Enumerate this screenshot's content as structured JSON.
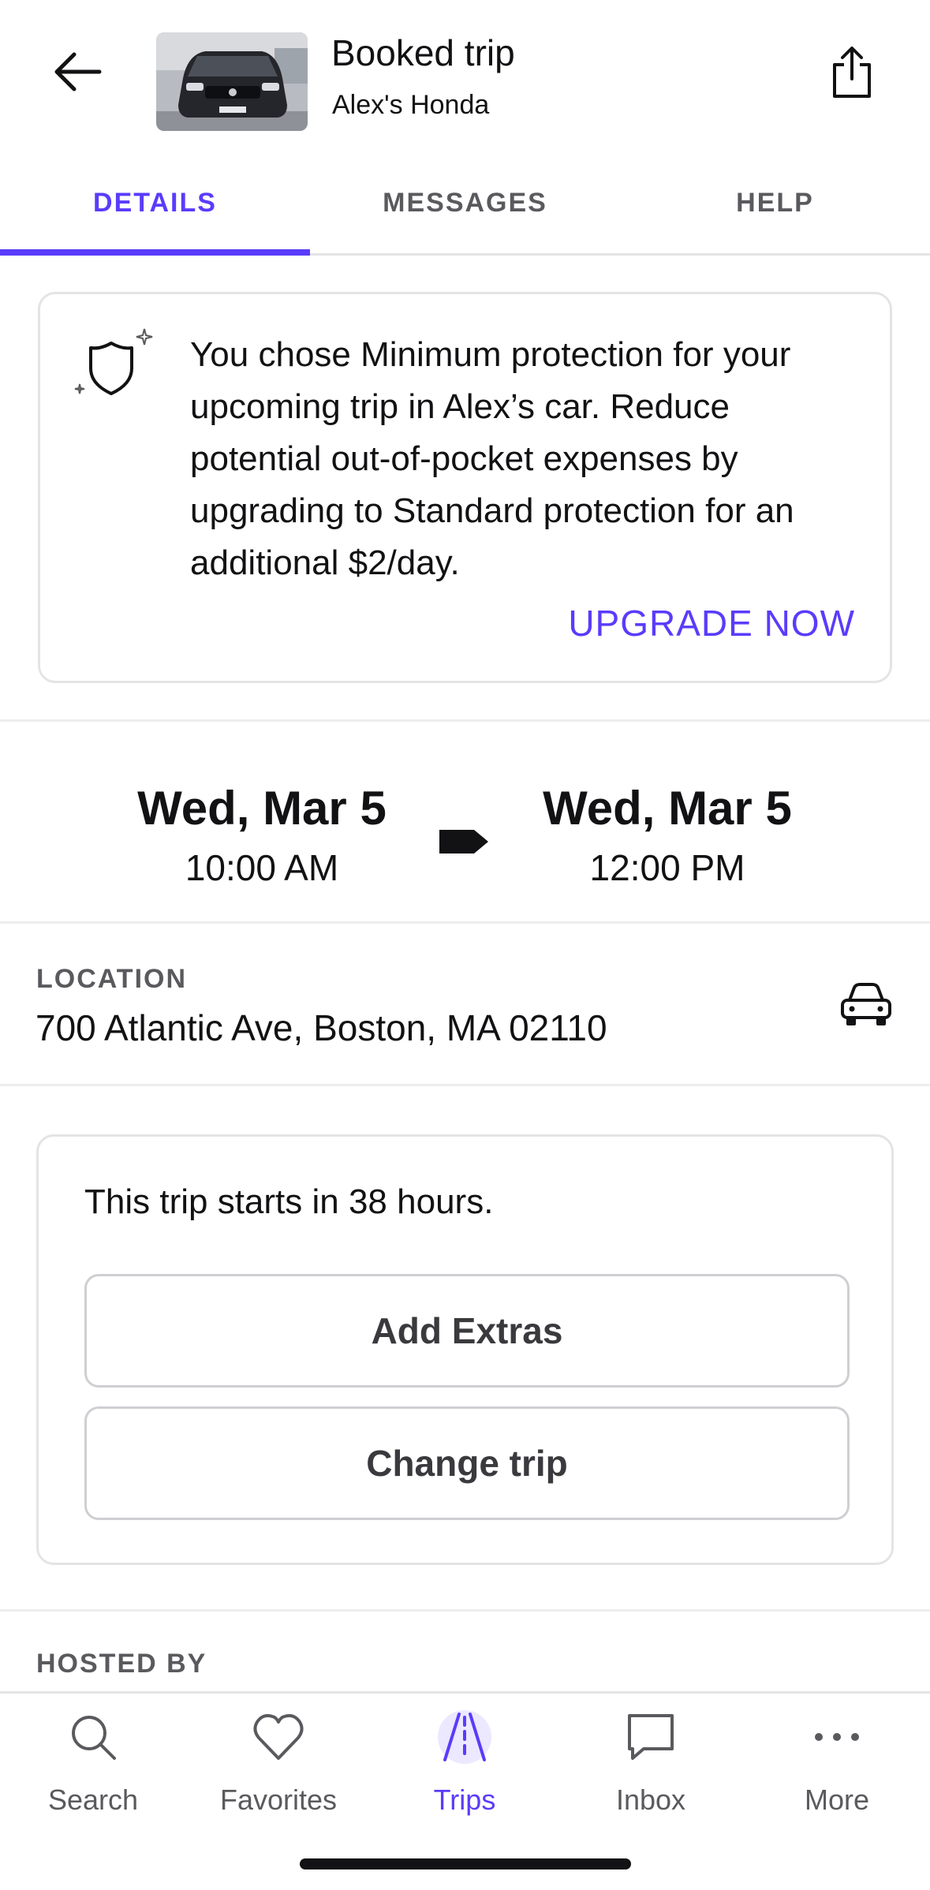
{
  "header": {
    "title": "Booked trip",
    "subtitle": "Alex's Honda"
  },
  "tabs": [
    {
      "label": "DETAILS",
      "active": true
    },
    {
      "label": "MESSAGES",
      "active": false
    },
    {
      "label": "HELP",
      "active": false
    }
  ],
  "protection": {
    "message": "You chose Minimum protection for your upcoming trip in Alex’s car. Reduce potential out-of-pocket expenses by upgrading to Standard protection for an additional $2/day.",
    "upgrade_label": "UPGRADE NOW"
  },
  "trip_dates": {
    "start": {
      "day": "Wed, Mar 5",
      "time": "10:00 AM"
    },
    "end": {
      "day": "Wed, Mar 5",
      "time": "12:00 PM"
    }
  },
  "location": {
    "label": "LOCATION",
    "address": "700 Atlantic Ave, Boston, MA 02110"
  },
  "trip_card": {
    "status": "This trip starts in 38 hours.",
    "add_extras_label": "Add Extras",
    "change_trip_label": "Change trip"
  },
  "hosted_by": {
    "label": "HOSTED BY"
  },
  "bottom_nav": [
    {
      "label": "Search",
      "icon": "search-icon",
      "active": false
    },
    {
      "label": "Favorites",
      "icon": "heart-icon",
      "active": false
    },
    {
      "label": "Trips",
      "icon": "road-icon",
      "active": true
    },
    {
      "label": "Inbox",
      "icon": "chat-icon",
      "active": false
    },
    {
      "label": "More",
      "icon": "more-icon",
      "active": false
    }
  ],
  "colors": {
    "accent": "#593cfb",
    "text": "#121214",
    "muted": "#5a5a5e",
    "border": "#e4e4e6"
  }
}
